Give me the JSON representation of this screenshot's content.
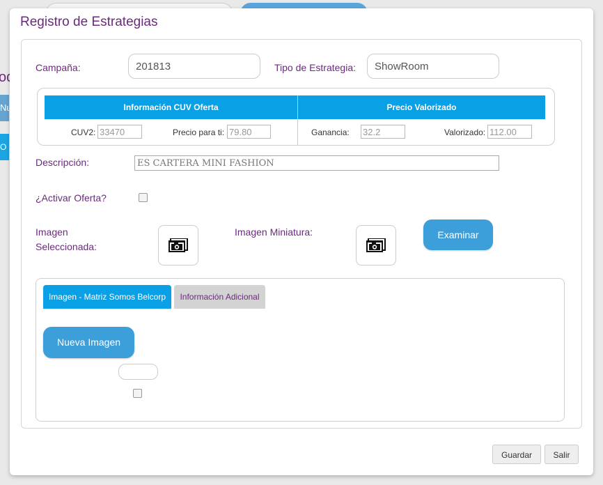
{
  "background": {
    "fragment_od": "od",
    "fragment_nu": "Nu",
    "fragment_o": "O"
  },
  "modal": {
    "title": "Registro de Estrategias",
    "campaign": {
      "label": "Campaña:",
      "value": "201813"
    },
    "strategy_type": {
      "label": "Tipo de Estrategia:",
      "value": "ShowRoom"
    },
    "cuv_offer": {
      "header": "Información CUV Oferta",
      "cuv2_label": "CUV2:",
      "cuv2_value": "33470",
      "price_label": "Precio para ti:",
      "price_value": "79.80"
    },
    "valued_price": {
      "header": "Precio Valorizado",
      "gain_label": "Ganancia:",
      "gain_value": "32.2",
      "valued_label": "Valorizado:",
      "valued_value": "112.00"
    },
    "description": {
      "label": "Descripción:",
      "value": "ES CARTERA MINI FASHION"
    },
    "activate_offer": {
      "label": "¿Activar Oferta?",
      "checked": false
    },
    "selected_image": {
      "label_line1": "Imagen",
      "label_line2": "Seleccionada:",
      "icon": "camera-icon"
    },
    "thumbnail_image": {
      "label": "Imagen Miniatura:",
      "icon": "camera-icon"
    },
    "browse_label": "Examinar",
    "tabs": [
      {
        "label": "Imagen - Matriz Somos Belcorp",
        "active": true
      },
      {
        "label": "Información Adicional",
        "active": false
      }
    ],
    "new_image_label": "Nueva Imagen",
    "save_label": "Guardar",
    "exit_label": "Salir"
  },
  "colors": {
    "accent": "#0aa0e6",
    "brand_purple": "#6b2a7d",
    "button_blue": "#3d9fda"
  }
}
